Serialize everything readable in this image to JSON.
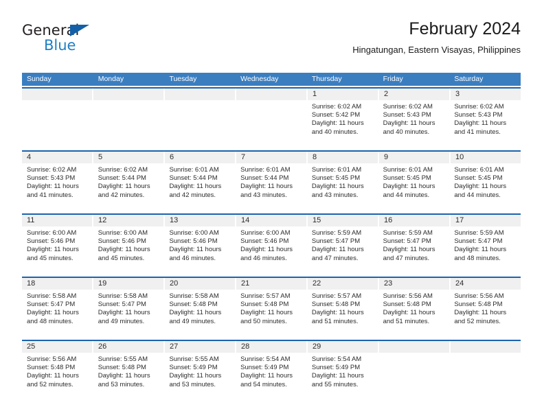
{
  "logo": {
    "word_top": "General",
    "word_bottom": "Blue",
    "triangle_icon": "blue-triangle-icon",
    "colors": {
      "dark": "#231f20",
      "blue": "#1f7fc4",
      "triangle": "#1360a8"
    }
  },
  "header": {
    "title": "February 2024",
    "subtitle": "Hingatungan, Eastern Visayas, Philippines"
  },
  "theme": {
    "header_blue": "#3b7ec0",
    "rule_blue": "#1b63ad",
    "band_gray": "#f0f0f0",
    "text": "#2b2b2b"
  },
  "weekdays": [
    "Sunday",
    "Monday",
    "Tuesday",
    "Wednesday",
    "Thursday",
    "Friday",
    "Saturday"
  ],
  "weeks": [
    [
      {
        "day": "",
        "lines": []
      },
      {
        "day": "",
        "lines": []
      },
      {
        "day": "",
        "lines": []
      },
      {
        "day": "",
        "lines": []
      },
      {
        "day": "1",
        "lines": [
          "Sunrise: 6:02 AM",
          "Sunset: 5:42 PM",
          "Daylight: 11 hours",
          "and 40 minutes."
        ]
      },
      {
        "day": "2",
        "lines": [
          "Sunrise: 6:02 AM",
          "Sunset: 5:43 PM",
          "Daylight: 11 hours",
          "and 40 minutes."
        ]
      },
      {
        "day": "3",
        "lines": [
          "Sunrise: 6:02 AM",
          "Sunset: 5:43 PM",
          "Daylight: 11 hours",
          "and 41 minutes."
        ]
      }
    ],
    [
      {
        "day": "4",
        "lines": [
          "Sunrise: 6:02 AM",
          "Sunset: 5:43 PM",
          "Daylight: 11 hours",
          "and 41 minutes."
        ]
      },
      {
        "day": "5",
        "lines": [
          "Sunrise: 6:02 AM",
          "Sunset: 5:44 PM",
          "Daylight: 11 hours",
          "and 42 minutes."
        ]
      },
      {
        "day": "6",
        "lines": [
          "Sunrise: 6:01 AM",
          "Sunset: 5:44 PM",
          "Daylight: 11 hours",
          "and 42 minutes."
        ]
      },
      {
        "day": "7",
        "lines": [
          "Sunrise: 6:01 AM",
          "Sunset: 5:44 PM",
          "Daylight: 11 hours",
          "and 43 minutes."
        ]
      },
      {
        "day": "8",
        "lines": [
          "Sunrise: 6:01 AM",
          "Sunset: 5:45 PM",
          "Daylight: 11 hours",
          "and 43 minutes."
        ]
      },
      {
        "day": "9",
        "lines": [
          "Sunrise: 6:01 AM",
          "Sunset: 5:45 PM",
          "Daylight: 11 hours",
          "and 44 minutes."
        ]
      },
      {
        "day": "10",
        "lines": [
          "Sunrise: 6:01 AM",
          "Sunset: 5:45 PM",
          "Daylight: 11 hours",
          "and 44 minutes."
        ]
      }
    ],
    [
      {
        "day": "11",
        "lines": [
          "Sunrise: 6:00 AM",
          "Sunset: 5:46 PM",
          "Daylight: 11 hours",
          "and 45 minutes."
        ]
      },
      {
        "day": "12",
        "lines": [
          "Sunrise: 6:00 AM",
          "Sunset: 5:46 PM",
          "Daylight: 11 hours",
          "and 45 minutes."
        ]
      },
      {
        "day": "13",
        "lines": [
          "Sunrise: 6:00 AM",
          "Sunset: 5:46 PM",
          "Daylight: 11 hours",
          "and 46 minutes."
        ]
      },
      {
        "day": "14",
        "lines": [
          "Sunrise: 6:00 AM",
          "Sunset: 5:46 PM",
          "Daylight: 11 hours",
          "and 46 minutes."
        ]
      },
      {
        "day": "15",
        "lines": [
          "Sunrise: 5:59 AM",
          "Sunset: 5:47 PM",
          "Daylight: 11 hours",
          "and 47 minutes."
        ]
      },
      {
        "day": "16",
        "lines": [
          "Sunrise: 5:59 AM",
          "Sunset: 5:47 PM",
          "Daylight: 11 hours",
          "and 47 minutes."
        ]
      },
      {
        "day": "17",
        "lines": [
          "Sunrise: 5:59 AM",
          "Sunset: 5:47 PM",
          "Daylight: 11 hours",
          "and 48 minutes."
        ]
      }
    ],
    [
      {
        "day": "18",
        "lines": [
          "Sunrise: 5:58 AM",
          "Sunset: 5:47 PM",
          "Daylight: 11 hours",
          "and 48 minutes."
        ]
      },
      {
        "day": "19",
        "lines": [
          "Sunrise: 5:58 AM",
          "Sunset: 5:47 PM",
          "Daylight: 11 hours",
          "and 49 minutes."
        ]
      },
      {
        "day": "20",
        "lines": [
          "Sunrise: 5:58 AM",
          "Sunset: 5:48 PM",
          "Daylight: 11 hours",
          "and 49 minutes."
        ]
      },
      {
        "day": "21",
        "lines": [
          "Sunrise: 5:57 AM",
          "Sunset: 5:48 PM",
          "Daylight: 11 hours",
          "and 50 minutes."
        ]
      },
      {
        "day": "22",
        "lines": [
          "Sunrise: 5:57 AM",
          "Sunset: 5:48 PM",
          "Daylight: 11 hours",
          "and 51 minutes."
        ]
      },
      {
        "day": "23",
        "lines": [
          "Sunrise: 5:56 AM",
          "Sunset: 5:48 PM",
          "Daylight: 11 hours",
          "and 51 minutes."
        ]
      },
      {
        "day": "24",
        "lines": [
          "Sunrise: 5:56 AM",
          "Sunset: 5:48 PM",
          "Daylight: 11 hours",
          "and 52 minutes."
        ]
      }
    ],
    [
      {
        "day": "25",
        "lines": [
          "Sunrise: 5:56 AM",
          "Sunset: 5:48 PM",
          "Daylight: 11 hours",
          "and 52 minutes."
        ]
      },
      {
        "day": "26",
        "lines": [
          "Sunrise: 5:55 AM",
          "Sunset: 5:48 PM",
          "Daylight: 11 hours",
          "and 53 minutes."
        ]
      },
      {
        "day": "27",
        "lines": [
          "Sunrise: 5:55 AM",
          "Sunset: 5:49 PM",
          "Daylight: 11 hours",
          "and 53 minutes."
        ]
      },
      {
        "day": "28",
        "lines": [
          "Sunrise: 5:54 AM",
          "Sunset: 5:49 PM",
          "Daylight: 11 hours",
          "and 54 minutes."
        ]
      },
      {
        "day": "29",
        "lines": [
          "Sunrise: 5:54 AM",
          "Sunset: 5:49 PM",
          "Daylight: 11 hours",
          "and 55 minutes."
        ]
      },
      {
        "day": "",
        "lines": []
      },
      {
        "day": "",
        "lines": []
      }
    ]
  ]
}
